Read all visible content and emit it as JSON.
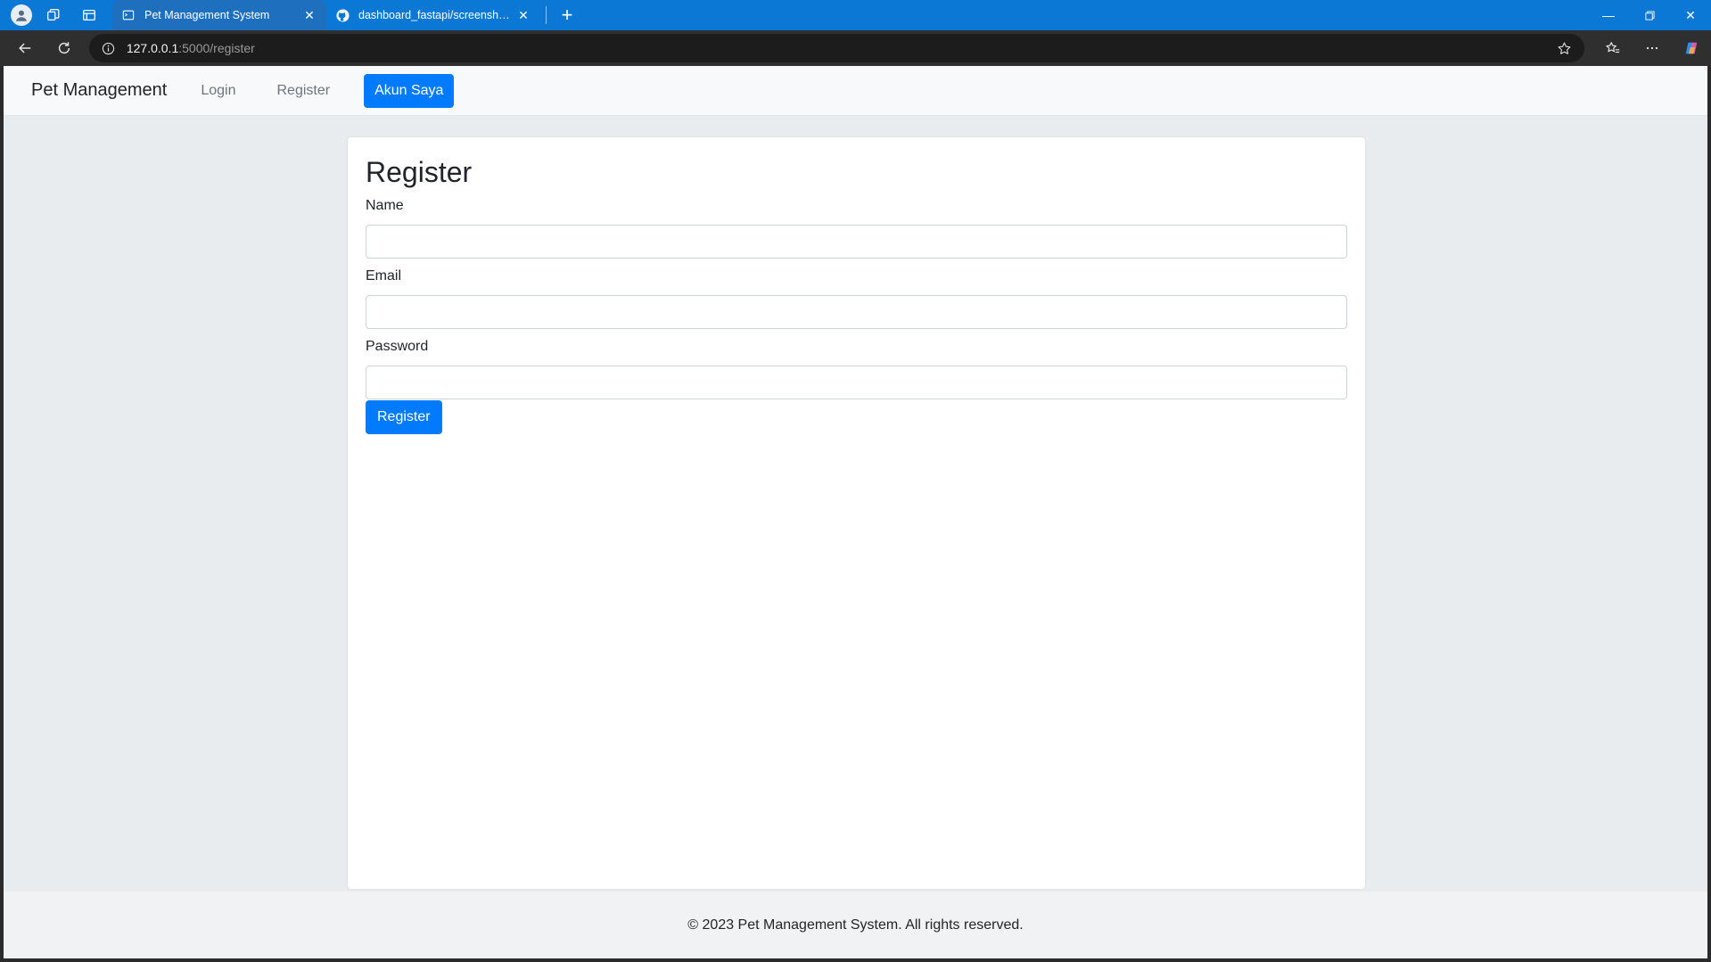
{
  "browser": {
    "tabs": [
      {
        "title": "Pet Management System",
        "active": true
      },
      {
        "title": "dashboard_fastapi/screenshots/",
        "active": false
      }
    ],
    "url_host": "127.0.0.1",
    "url_rest": ":5000/register"
  },
  "navbar": {
    "brand": "Pet Management",
    "links": [
      "Login",
      "Register"
    ],
    "account_button": "Akun Saya"
  },
  "form": {
    "title": "Register",
    "fields": [
      {
        "label": "Name",
        "value": ""
      },
      {
        "label": "Email",
        "value": ""
      },
      {
        "label": "Password",
        "value": ""
      }
    ],
    "submit_label": "Register"
  },
  "footer": {
    "text": "© 2023 Pet Management System. All rights reserved."
  },
  "colors": {
    "primary": "#007bff",
    "tabstrip": "#0a78d4"
  }
}
